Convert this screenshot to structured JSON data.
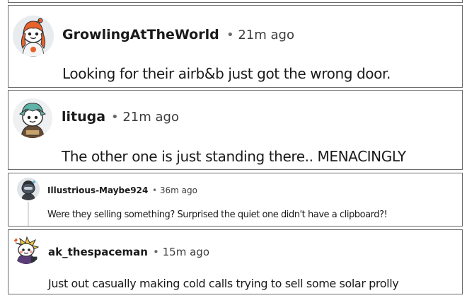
{
  "comments": [
    {
      "username": "GrowlingAtTheWorld",
      "timestamp": "21m ago",
      "text": "Looking for their airb&b just got the wrong door."
    },
    {
      "username": "lituga",
      "timestamp": "21m ago",
      "text": "The other one is just standing there.. MENACINGLY"
    },
    {
      "username": "Illustrious-Maybe924",
      "timestamp": "36m ago",
      "text": "Were they selling something? Surprised the quiet one didn't have a clipboard?!"
    },
    {
      "username": "ak_thespaceman",
      "timestamp": "15m ago",
      "text": "Just out casually making cold calls trying to sell some solar prolly"
    }
  ],
  "separator": "•"
}
